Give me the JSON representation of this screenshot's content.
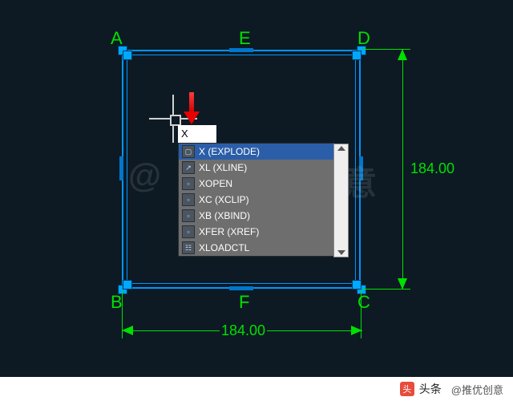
{
  "vertices": {
    "A": "A",
    "B": "B",
    "C": "C",
    "D": "D",
    "E": "E",
    "F": "F"
  },
  "dimensions": {
    "width": "184.00",
    "height": "184.00"
  },
  "command_input": "X",
  "autocomplete": [
    {
      "label": "X (EXPLODE)",
      "icon": "▢",
      "selected": true
    },
    {
      "label": "XL (XLINE)",
      "icon": "↗",
      "selected": false
    },
    {
      "label": "XOPEN",
      "icon": "▫",
      "selected": false
    },
    {
      "label": "XC (XCLIP)",
      "icon": "▫",
      "selected": false
    },
    {
      "label": "XB (XBIND)",
      "icon": "▫",
      "selected": false
    },
    {
      "label": "XFER (XREF)",
      "icon": "▫",
      "selected": false
    },
    {
      "label": "XLOADCTL",
      "icon": "☷",
      "selected": false
    }
  ],
  "watermark": {
    "left": "@",
    "right": "优创意"
  },
  "footer": {
    "brand": "头条",
    "author": "@推优创意"
  }
}
